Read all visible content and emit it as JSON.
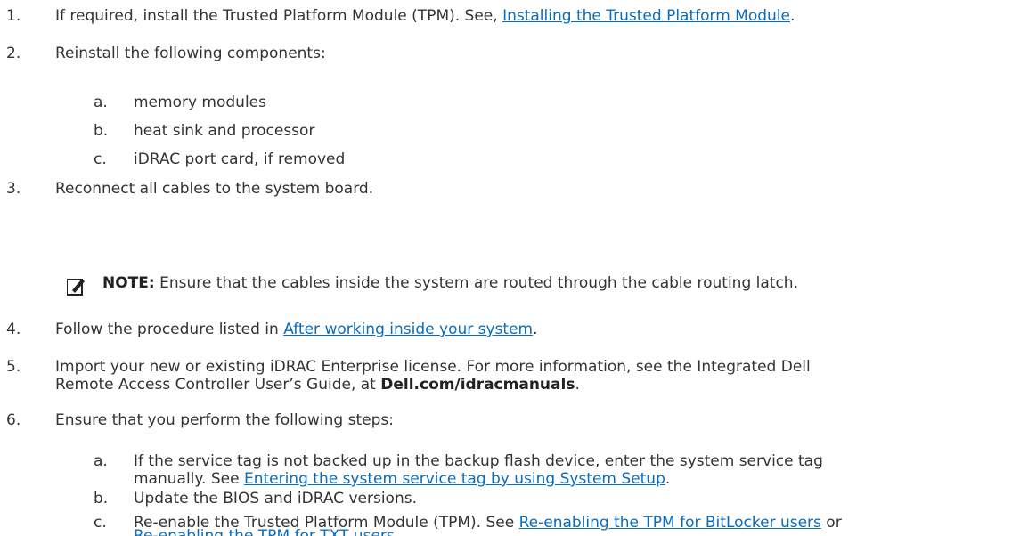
{
  "steps": [
    {
      "num": "1.",
      "pre": "If required, install the Trusted Platform Module (TPM). See, ",
      "link": "Installing the Trusted Platform Module",
      "post": "."
    },
    {
      "num": "2.",
      "text": "Reinstall the following components:"
    },
    {
      "num": "3.",
      "text": "Reconnect all cables to the system board."
    },
    {
      "num": "4.",
      "pre": "Follow the procedure listed in ",
      "link": "After working inside your system",
      "post": "."
    },
    {
      "num": "5.",
      "line1": "Import your new or existing iDRAC Enterprise license. For more information, see the Integrated Dell",
      "line2_pre": "Remote Access Controller User’s Guide, at ",
      "line2_bold": "Dell.com/idracmanuals",
      "line2_post": "."
    },
    {
      "num": "6.",
      "text": "Ensure that you perform the following steps:"
    }
  ],
  "step2_items": [
    {
      "letter": "a.",
      "text": "memory modules"
    },
    {
      "letter": "b.",
      "text": "heat sink and processor"
    },
    {
      "letter": "c.",
      "text": "iDRAC port card, if removed"
    }
  ],
  "note": {
    "label": "NOTE:",
    "text": " Ensure that the cables inside the system are routed through the cable routing latch.",
    "icon": "pencil-note-icon"
  },
  "step6_items": {
    "a": {
      "letter": "a.",
      "line1": "If the service tag is not backed up in the backup flash device, enter the system service tag",
      "line2_pre": "manually. See ",
      "link": "Entering the system service tag by using System Setup",
      "line2_post": "."
    },
    "b": {
      "letter": "b.",
      "text": "Update the BIOS and iDRAC versions."
    },
    "c": {
      "letter": "c.",
      "line1_pre": "Re-enable the Trusted Platform Module (TPM). See ",
      "link1": "Re-enabling the TPM for BitLocker users",
      "or": " or",
      "link2": "Re-enabling the TPM for TXT users",
      "line2_post": "."
    }
  },
  "colors": {
    "text": "#333333",
    "link": "#0a6cbd"
  }
}
